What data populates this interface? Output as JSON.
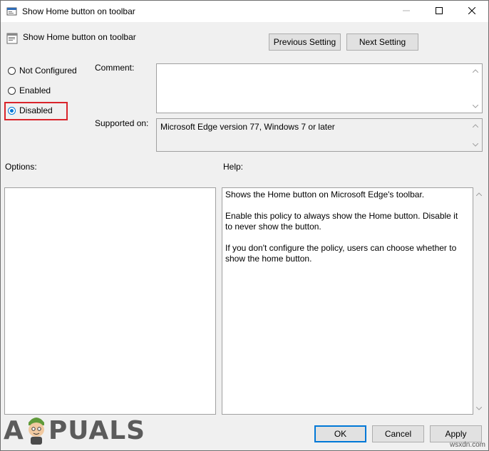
{
  "window": {
    "title": "Show Home button on toolbar"
  },
  "header": {
    "title": "Show Home button on toolbar",
    "prev_label": "Previous Setting",
    "next_label": "Next Setting"
  },
  "state": {
    "options": [
      {
        "label": "Not Configured",
        "checked": false
      },
      {
        "label": "Enabled",
        "checked": false
      },
      {
        "label": "Disabled",
        "checked": true
      }
    ]
  },
  "comment": {
    "label": "Comment:",
    "value": ""
  },
  "supported": {
    "label": "Supported on:",
    "value": "Microsoft Edge version 77, Windows 7 or later"
  },
  "options_panel": {
    "label": "Options:"
  },
  "help": {
    "label": "Help:",
    "text": "Shows the Home button on Microsoft Edge's toolbar.\n\nEnable this policy to always show the Home button. Disable it to never show the button.\n\nIf you don't configure the policy, users can choose whether to show the home button."
  },
  "footer": {
    "ok_label": "OK",
    "cancel_label": "Cancel",
    "apply_label": "Apply"
  },
  "watermark": {
    "text_a": "A",
    "text_rest": "PUALS",
    "site": "wsxdn.com"
  },
  "colors": {
    "accent": "#0078d7",
    "highlight": "#d9242b"
  }
}
